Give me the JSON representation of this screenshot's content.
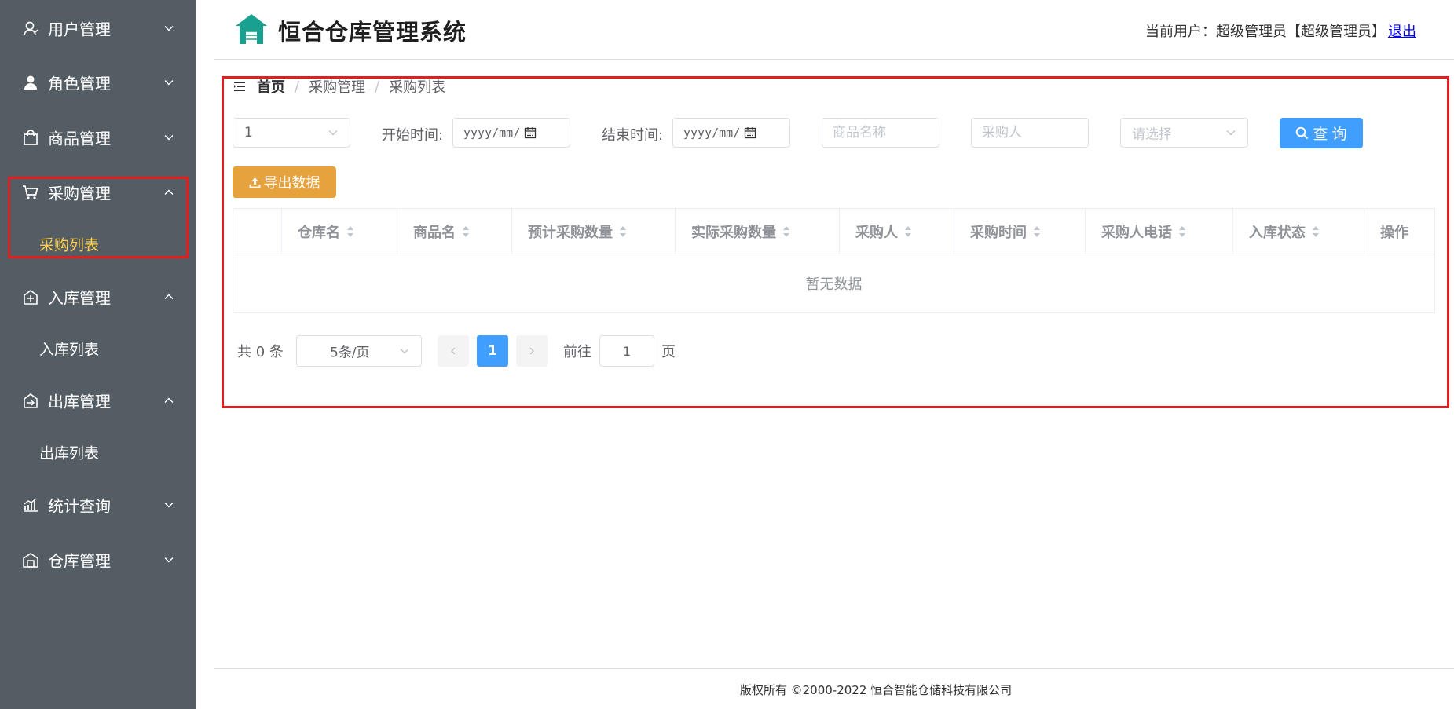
{
  "app": {
    "title": "恒合仓库管理系统",
    "logo_icon": "warehouse-icon"
  },
  "user": {
    "label": "当前用户：超级管理员【超级管理员】",
    "logout": "退出"
  },
  "sidebar": {
    "items": [
      {
        "label": "用户管理",
        "icon": "user-icon",
        "arrow": "down"
      },
      {
        "label": "角色管理",
        "icon": "role-icon",
        "arrow": "down"
      },
      {
        "label": "商品管理",
        "icon": "shopping-bag-icon",
        "arrow": "down"
      },
      {
        "label": "采购管理",
        "icon": "cart-icon",
        "arrow": "up",
        "sub": [
          "采购列表"
        ]
      },
      {
        "label": "入库管理",
        "icon": "inbound-icon",
        "arrow": "up",
        "sub": [
          "入库列表"
        ]
      },
      {
        "label": "出库管理",
        "icon": "outbound-icon",
        "arrow": "up",
        "sub": [
          "出库列表"
        ]
      },
      {
        "label": "统计查询",
        "icon": "chart-icon",
        "arrow": "down"
      },
      {
        "label": "仓库管理",
        "icon": "warehouse-building-icon",
        "arrow": "down"
      }
    ],
    "active_sub": "采购列表",
    "colors": {
      "bg": "#545c64",
      "active": "#ffd04b"
    }
  },
  "breadcrumb": {
    "home": "首页",
    "items": [
      "采购管理",
      "采购列表"
    ]
  },
  "filters": {
    "warehouse_select": "1",
    "start_label": "开始时间:",
    "end_label": "结束时间:",
    "date_placeholder": "yyyy/mm/",
    "product_placeholder": "商品名称",
    "buyer_placeholder": "采购人",
    "status_placeholder": "请选择",
    "query_button": "查 询",
    "export_button": "导出数据"
  },
  "table": {
    "columns": [
      "仓库名",
      "商品名",
      "预计采购数量",
      "实际采购数量",
      "采购人",
      "采购时间",
      "采购人电话",
      "入库状态",
      "操作"
    ],
    "empty_text": "暂无数据"
  },
  "pagination": {
    "total": "共 0 条",
    "page_size": "5条/页",
    "current_page": "1",
    "goto_label": "前往",
    "goto_value": "1",
    "page_label": "页"
  },
  "footer": {
    "text": "版权所有 ©2000-2022  恒合智能仓储科技有限公司"
  },
  "colors": {
    "primary": "#409eff",
    "warning": "#e6a23c",
    "highlight": "#e02020"
  }
}
